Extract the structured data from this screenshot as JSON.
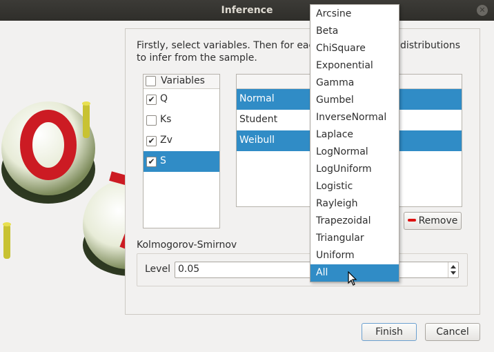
{
  "window": {
    "title": "Inference"
  },
  "instructions": "Firstly, select variables. Then for each variable, select distributions to infer from the sample.",
  "variables": {
    "header": "Variables",
    "header_checked": false,
    "items": [
      {
        "label": "Q",
        "checked": true,
        "selected": false
      },
      {
        "label": "Ks",
        "checked": false,
        "selected": false
      },
      {
        "label": "Zv",
        "checked": true,
        "selected": false
      },
      {
        "label": "S",
        "checked": true,
        "selected": true
      }
    ]
  },
  "distributions": {
    "items": [
      {
        "label": "Normal",
        "selected": true
      },
      {
        "label": "Student",
        "selected": false
      },
      {
        "label": "Weibull",
        "selected": true
      }
    ],
    "remove_label": "Remove"
  },
  "ks": {
    "title": "Kolmogorov-Smirnov",
    "level_label": "Level",
    "level_value": "0.05"
  },
  "dropdown": {
    "items": [
      "Arcsine",
      "Beta",
      "ChiSquare",
      "Exponential",
      "Gamma",
      "Gumbel",
      "InverseNormal",
      "Laplace",
      "LogNormal",
      "LogUniform",
      "Logistic",
      "Rayleigh",
      "Trapezoidal",
      "Triangular",
      "Uniform",
      "All"
    ],
    "selected": "All"
  },
  "buttons": {
    "finish": "Finish",
    "cancel": "Cancel"
  },
  "colors": {
    "selection": "#308cc6",
    "titlebar": "#3c3b37",
    "remove_icon": "#dd1111"
  },
  "icons": {
    "close": "close-icon",
    "remove": "minus-icon",
    "cursor": "pointer-cursor-icon"
  }
}
